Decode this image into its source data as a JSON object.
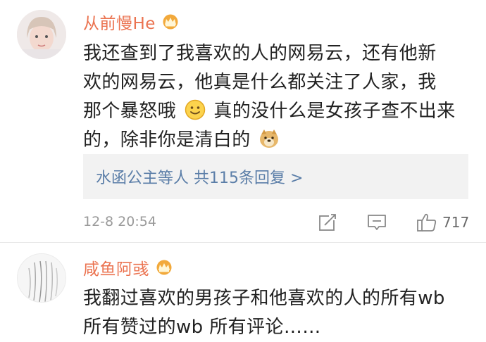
{
  "comments": [
    {
      "username": "从前慢He",
      "text_lines": [
        "我还查到了我喜欢的人的网易云，还有他新",
        "欢的网易云，他真是什么都关注了人家，我",
        "那个暴怒哦",
        "真的没什么是女孩子查不出来",
        "的，除非你是清白的"
      ],
      "reply_summary": "水函公主等人  共115条回复 >",
      "timestamp": "12-8 20:54",
      "likes": "717"
    },
    {
      "username": "咸鱼阿彧",
      "text_lines": [
        "我翻过喜欢的男孩子和他喜欢的人的所有wb",
        "所有赞过的wb 所有评论……"
      ]
    }
  ],
  "colors": {
    "username": "#eb7350",
    "reply_link": "#5b7ea8",
    "meta": "#9a9a9a"
  },
  "icons": [
    "crown-badge-icon",
    "smile-emoji-icon",
    "doge-emoji-icon",
    "repost-icon",
    "comment-icon",
    "like-icon"
  ]
}
